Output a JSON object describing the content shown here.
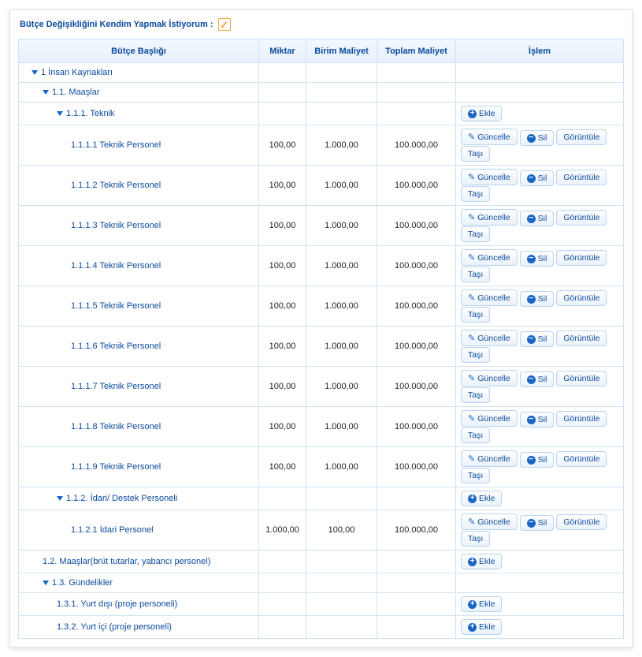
{
  "top": {
    "label": "Bütçe Değişikliğini Kendim Yapmak İstiyorum :",
    "checked": "✓"
  },
  "headers": {
    "title": "Bütçe Başlığı",
    "qty": "Miktar",
    "unit": "Birim Maliyet",
    "total": "Toplam Maliyet",
    "action": "İşlem"
  },
  "buttons": {
    "add": "Ekle",
    "update": "Güncelle",
    "delete": "Sil",
    "view": "Görüntüle",
    "move": "Taşı"
  },
  "rows": [
    {
      "label": "1 İnsan Kaynakları",
      "indent": 1,
      "caret": true,
      "qty": "",
      "unit": "",
      "total": "",
      "actions": []
    },
    {
      "label": "1.1. Maaşlar",
      "indent": 2,
      "caret": true,
      "qty": "",
      "unit": "",
      "total": "",
      "actions": []
    },
    {
      "label": "1.1.1. Teknik",
      "indent": 3,
      "caret": true,
      "qty": "",
      "unit": "",
      "total": "",
      "actions": [
        "add"
      ]
    },
    {
      "label": "1.1.1.1 Teknik Personel",
      "indent": 4,
      "caret": false,
      "qty": "100,00",
      "unit": "1.000,00",
      "total": "100.000,00",
      "actions": [
        "crud"
      ]
    },
    {
      "label": "1.1.1.2 Teknik Personel",
      "indent": 4,
      "caret": false,
      "qty": "100,00",
      "unit": "1.000,00",
      "total": "100.000,00",
      "actions": [
        "crud"
      ]
    },
    {
      "label": "1.1.1.3 Teknik Personel",
      "indent": 4,
      "caret": false,
      "qty": "100,00",
      "unit": "1.000,00",
      "total": "100.000,00",
      "actions": [
        "crud"
      ]
    },
    {
      "label": "1.1.1.4 Teknik Personel",
      "indent": 4,
      "caret": false,
      "qty": "100,00",
      "unit": "1.000,00",
      "total": "100.000,00",
      "actions": [
        "crud"
      ]
    },
    {
      "label": "1.1.1.5 Teknik Personel",
      "indent": 4,
      "caret": false,
      "qty": "100,00",
      "unit": "1.000,00",
      "total": "100.000,00",
      "actions": [
        "crud"
      ]
    },
    {
      "label": "1.1.1.6 Teknik Personel",
      "indent": 4,
      "caret": false,
      "qty": "100,00",
      "unit": "1.000,00",
      "total": "100.000,00",
      "actions": [
        "crud"
      ]
    },
    {
      "label": "1.1.1.7 Teknik Personel",
      "indent": 4,
      "caret": false,
      "qty": "100,00",
      "unit": "1.000,00",
      "total": "100.000,00",
      "actions": [
        "crud"
      ]
    },
    {
      "label": "1.1.1.8 Teknik Personel",
      "indent": 4,
      "caret": false,
      "qty": "100,00",
      "unit": "1.000,00",
      "total": "100.000,00",
      "actions": [
        "crud"
      ]
    },
    {
      "label": "1.1.1.9 Teknik Personel",
      "indent": 4,
      "caret": false,
      "qty": "100,00",
      "unit": "1.000,00",
      "total": "100.000,00",
      "actions": [
        "crud"
      ]
    },
    {
      "label": "1.1.2. İdari/ Destek Personeli",
      "indent": 3,
      "caret": true,
      "qty": "",
      "unit": "",
      "total": "",
      "actions": [
        "add"
      ]
    },
    {
      "label": "1.1.2.1 İdari Personel",
      "indent": 4,
      "caret": false,
      "qty": "1.000,00",
      "unit": "100,00",
      "total": "100.000,00",
      "actions": [
        "crud"
      ]
    },
    {
      "label": "1.2. Maaşlar(brüt tutarlar, yabancı personel)",
      "indent": 2,
      "caret": false,
      "qty": "",
      "unit": "",
      "total": "",
      "actions": [
        "add"
      ]
    },
    {
      "label": "1.3. Gündelikler",
      "indent": 2,
      "caret": true,
      "qty": "",
      "unit": "",
      "total": "",
      "actions": []
    },
    {
      "label": "1.3.1. Yurt dışı (proje personeli)",
      "indent": 3,
      "caret": false,
      "qty": "",
      "unit": "",
      "total": "",
      "actions": [
        "add"
      ]
    },
    {
      "label": "1.3.2. Yurt içi (proje personeli)",
      "indent": 3,
      "caret": false,
      "qty": "",
      "unit": "",
      "total": "",
      "actions": [
        "add"
      ]
    }
  ]
}
